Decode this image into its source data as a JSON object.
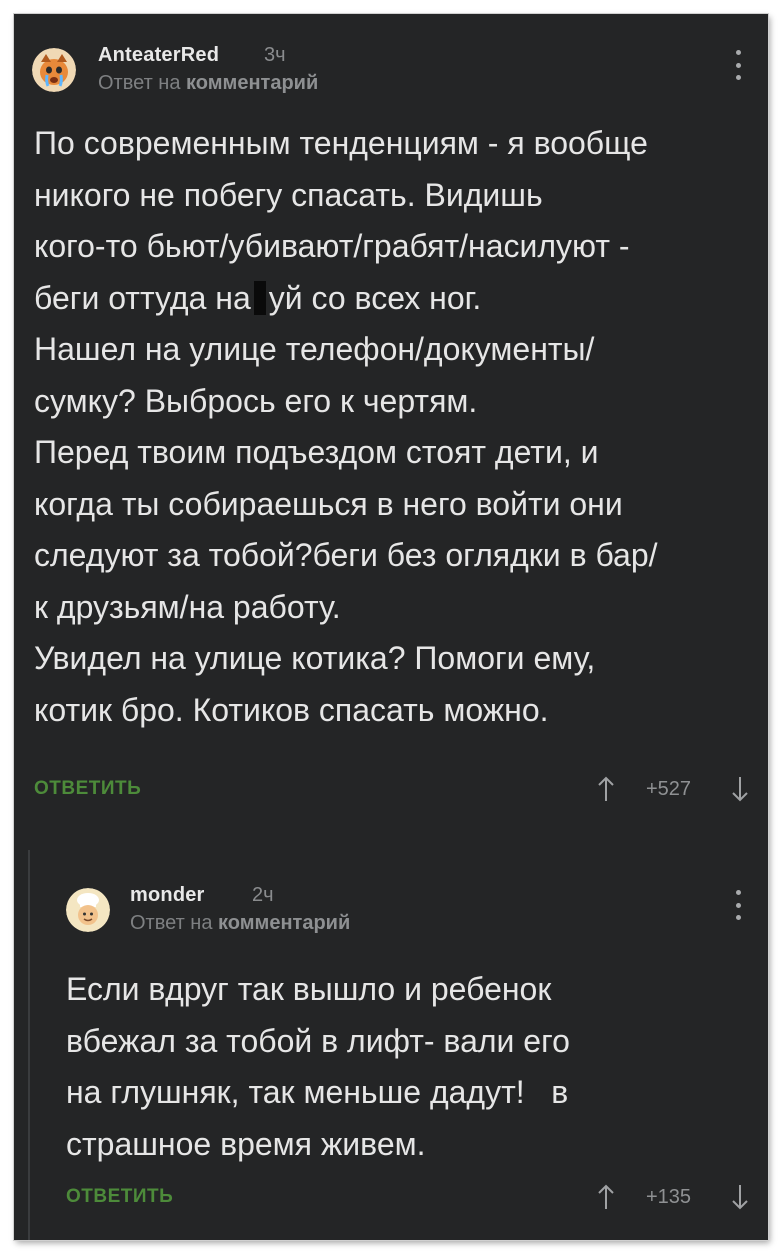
{
  "comments": [
    {
      "username": "AnteaterRed",
      "time": "3ч",
      "reply_prefix": "Ответ на",
      "reply_link": "комментарий",
      "body_before_censor": "По современным тенденциям - я вообще\nникого не побегу спасать. Видишь\nкого-то бьют/убивают/грабят/насилуют -\nбеги оттуда на",
      "body_after_censor": "уй со всех ног.\nНашел на улице телефон/документы/\nсумку? Выбрось его к чертям.\nПеред твоим подъездом стоят дети, и\nкогда ты собираешься в него войти они\nследуют за тобой?беги без оглядки в бар/\nк друзьям/на работу.\nУвидел на улице котика? Помоги ему,\nкотик бро. Котиков спасать можно.",
      "reply_label": "ОТВЕТИТЬ",
      "rating": "+527"
    },
    {
      "username": "monder",
      "time": "2ч",
      "reply_prefix": "Ответ на",
      "reply_link": "комментарий",
      "body": "Если вдруг так вышло и ребенок\nвбежал за тобой в лифт- вали его\nна глушняк, так меньше дадут!   в\nстрашное время живем.",
      "reply_label": "ОТВЕТИТЬ",
      "rating": "+135"
    }
  ],
  "colors": {
    "background": "#242526",
    "text": "#e6e6e6",
    "reply_button": "#4d8b3a",
    "muted": "#8a8c8e"
  },
  "icons": [
    "avatar-crying-icon",
    "avatar-chef-icon",
    "kebab-menu-icon",
    "arrow-up-icon",
    "arrow-down-icon"
  ]
}
